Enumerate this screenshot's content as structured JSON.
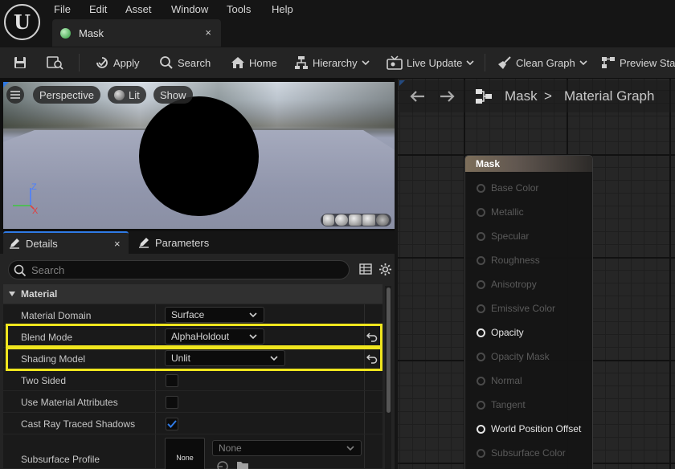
{
  "menu": {
    "items": [
      "File",
      "Edit",
      "Asset",
      "Window",
      "Tools",
      "Help"
    ]
  },
  "tab": {
    "title": "Mask",
    "close": "×"
  },
  "toolbar": {
    "apply": "Apply",
    "search": "Search",
    "home": "Home",
    "hierarchy": "Hierarchy",
    "live_update": "Live Update",
    "clean_graph": "Clean Graph",
    "preview_stats": "Preview Sta"
  },
  "viewport": {
    "perspective": "Perspective",
    "lit": "Lit",
    "show": "Show",
    "axis_z": "Z",
    "axis_x": "X"
  },
  "panel": {
    "details_tab": "Details",
    "details_close": "×",
    "parameters_tab": "Parameters",
    "search_placeholder": "Search",
    "section": "Material",
    "rows": {
      "material_domain": {
        "label": "Material Domain",
        "value": "Surface"
      },
      "blend_mode": {
        "label": "Blend Mode",
        "value": "AlphaHoldout"
      },
      "shading_model": {
        "label": "Shading Model",
        "value": "Unlit"
      },
      "two_sided": {
        "label": "Two Sided",
        "checked": false
      },
      "use_material_attributes": {
        "label": "Use Material Attributes",
        "checked": false
      },
      "cast_ray_traced_shadows": {
        "label": "Cast Ray Traced Shadows",
        "checked": true
      },
      "subsurface_profile": {
        "label": "Subsurface Profile",
        "thumb": "None",
        "value": "None"
      }
    }
  },
  "graph": {
    "breadcrumb_asset": "Mask",
    "breadcrumb_separator": ">",
    "breadcrumb_graph": "Material Graph",
    "node_title": "Mask",
    "pins": [
      {
        "label": "Base Color",
        "active": false
      },
      {
        "label": "Metallic",
        "active": false
      },
      {
        "label": "Specular",
        "active": false
      },
      {
        "label": "Roughness",
        "active": false
      },
      {
        "label": "Anisotropy",
        "active": false
      },
      {
        "label": "Emissive Color",
        "active": false
      },
      {
        "label": "Opacity",
        "active": true
      },
      {
        "label": "Opacity Mask",
        "active": false
      },
      {
        "label": "Normal",
        "active": false
      },
      {
        "label": "Tangent",
        "active": false
      },
      {
        "label": "World Position Offset",
        "active": true
      },
      {
        "label": "Subsurface Color",
        "active": false
      }
    ]
  },
  "colors": {
    "accent": "#2f7ae5",
    "highlight": "#f0e61e",
    "check": "#2f7ae5"
  }
}
